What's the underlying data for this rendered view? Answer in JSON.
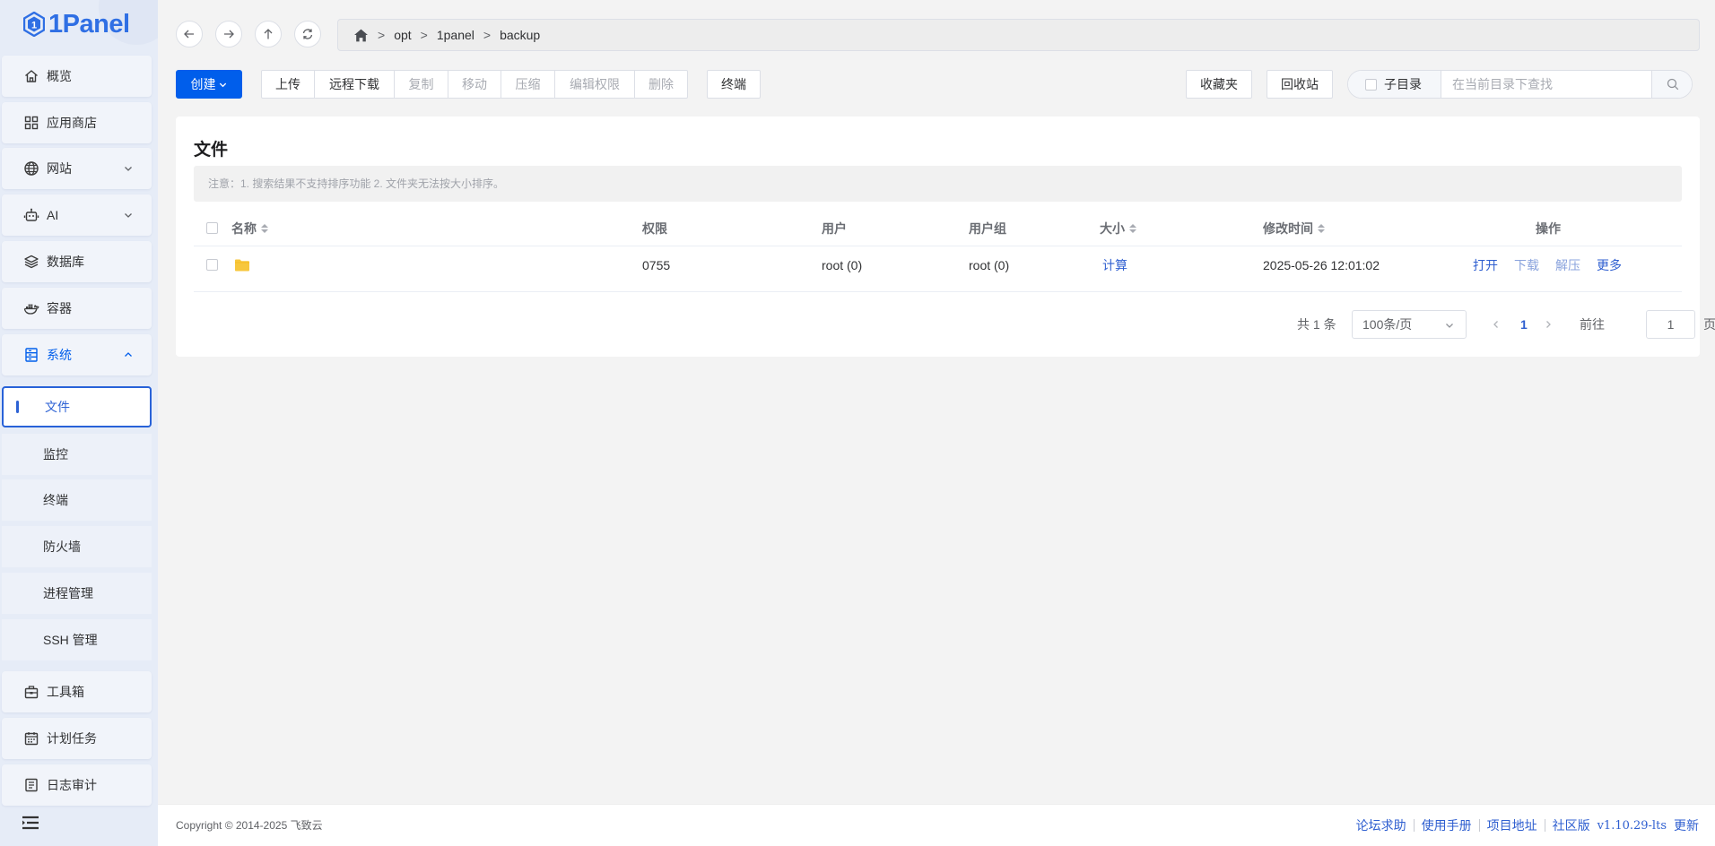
{
  "brand": {
    "name": "1Panel",
    "logo_icon": "1panel-logo-icon"
  },
  "sidebar": {
    "items": [
      {
        "label": "概览",
        "icon": "home-icon"
      },
      {
        "label": "应用商店",
        "icon": "apps-grid-icon"
      },
      {
        "label": "网站",
        "icon": "globe-icon",
        "expandable": true
      },
      {
        "label": "AI",
        "icon": "robot-icon",
        "expandable": true
      },
      {
        "label": "数据库",
        "icon": "layers-icon"
      },
      {
        "label": "容器",
        "icon": "docker-icon"
      },
      {
        "label": "系统",
        "icon": "server-icon",
        "expanded": true,
        "active": true
      },
      {
        "label": "工具箱",
        "icon": "toolbox-icon"
      },
      {
        "label": "计划任务",
        "icon": "calendar-icon"
      },
      {
        "label": "日志审计",
        "icon": "log-icon"
      }
    ],
    "system_sub_items": [
      {
        "label": "文件",
        "selected": true
      },
      {
        "label": "监控"
      },
      {
        "label": "终端"
      },
      {
        "label": "防火墙"
      },
      {
        "label": "进程管理"
      },
      {
        "label": "SSH 管理"
      }
    ]
  },
  "breadcrumb": {
    "home_icon": "home-icon",
    "separator": ">",
    "segments": [
      "opt",
      "1panel",
      "backup"
    ]
  },
  "toolbar": {
    "create": "创建",
    "upload": "上传",
    "remote_download": "远程下载",
    "copy": "复制",
    "move": "移动",
    "compress": "压缩",
    "edit_permission": "编辑权限",
    "delete": "删除",
    "terminal": "终端",
    "favorites": "收藏夹",
    "recycle_bin": "回收站",
    "subdir_label": "子目录",
    "search_placeholder": "在当前目录下查找"
  },
  "card": {
    "title": "文件",
    "notice": "注意：1. 搜索结果不支持排序功能 2. 文件夹无法按大小排序。"
  },
  "table": {
    "headers": {
      "name": "名称",
      "permission": "权限",
      "user": "用户",
      "group": "用户组",
      "size": "大小",
      "modified": "修改时间",
      "actions": "操作"
    },
    "rows": [
      {
        "name": "",
        "icon": "folder-icon",
        "permission": "0755",
        "user": "root (0)",
        "group": "root (0)",
        "size": "计算",
        "modified": "2025-05-26 12:01:02",
        "actions": {
          "open": "打开",
          "download": "下载",
          "decompress": "解压",
          "more": "更多"
        }
      }
    ]
  },
  "pagination": {
    "total": "共 1 条",
    "page_size": "100条/页",
    "current_page": "1",
    "goto_label": "前往",
    "goto_value": "1",
    "page_suffix": "页"
  },
  "footer": {
    "copyright": "Copyright © 2014-2025 飞致云",
    "links": [
      "论坛求助",
      "使用手册",
      "项目地址",
      "社区版"
    ],
    "version": "v1.10.29-lts",
    "update": "更新"
  },
  "colors": {
    "primary": "#005eeb",
    "link": "#2f5fd0",
    "sidebar_bg": "#e6ecf7",
    "folder": "#f7c73d"
  }
}
